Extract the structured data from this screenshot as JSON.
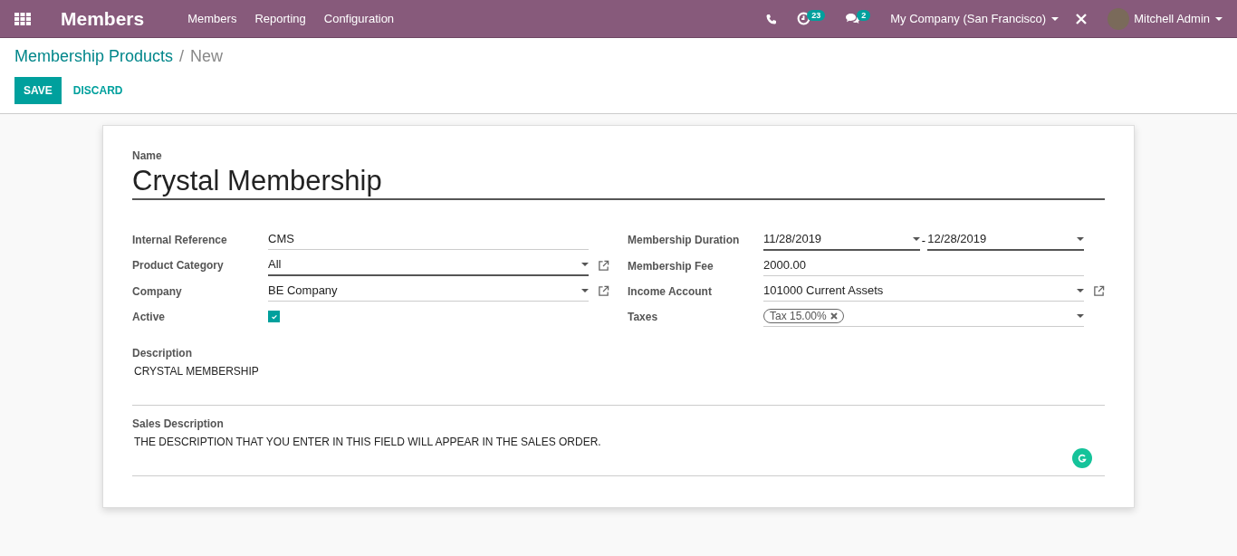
{
  "navbar": {
    "app_title": "Members",
    "menu": [
      "Members",
      "Reporting",
      "Configuration"
    ],
    "activity_badge": "23",
    "message_badge": "2",
    "company": "My Company (San Francisco)",
    "user": "Mitchell Admin"
  },
  "breadcrumb": {
    "parent": "Membership Products",
    "separator": "/",
    "current": "New"
  },
  "buttons": {
    "save": "SAVE",
    "discard": "DISCARD"
  },
  "form": {
    "name_label": "Name",
    "name_value": "Crystal Membership",
    "left_fields": [
      {
        "label": "Internal Reference",
        "kind": "text",
        "value": "CMS",
        "required": false,
        "external_link": false
      },
      {
        "label": "Product Category",
        "kind": "select",
        "value": "All",
        "required": true,
        "external_link": true
      },
      {
        "label": "Company",
        "kind": "select",
        "value": "BE Company",
        "required": false,
        "external_link": true
      },
      {
        "label": "Active",
        "kind": "checkbox",
        "checked": true
      }
    ],
    "right_fields": [
      {
        "label": "Membership Duration",
        "kind": "daterange",
        "value": "11/28/2019",
        "range_separator": "-",
        "value_end": "12/28/2019",
        "required": true,
        "external_link": false
      },
      {
        "label": "Membership Fee",
        "kind": "text",
        "value": "2000.00",
        "required": false,
        "external_link": false
      },
      {
        "label": "Income Account",
        "kind": "select",
        "value": "101000 Current Assets",
        "required": false,
        "external_link": true
      },
      {
        "label": "Taxes",
        "kind": "tags",
        "tags": [
          "Tax 15.00%"
        ],
        "required": false,
        "external_link": false
      }
    ],
    "description_label": "Description",
    "description": "CRYSTAL MEMBERSHIP",
    "sales_description_label": "Sales Description",
    "sales_description": "THE DESCRIPTION THAT YOU ENTER IN THIS FIELD WILL APPEAR IN THE SALES ORDER."
  }
}
